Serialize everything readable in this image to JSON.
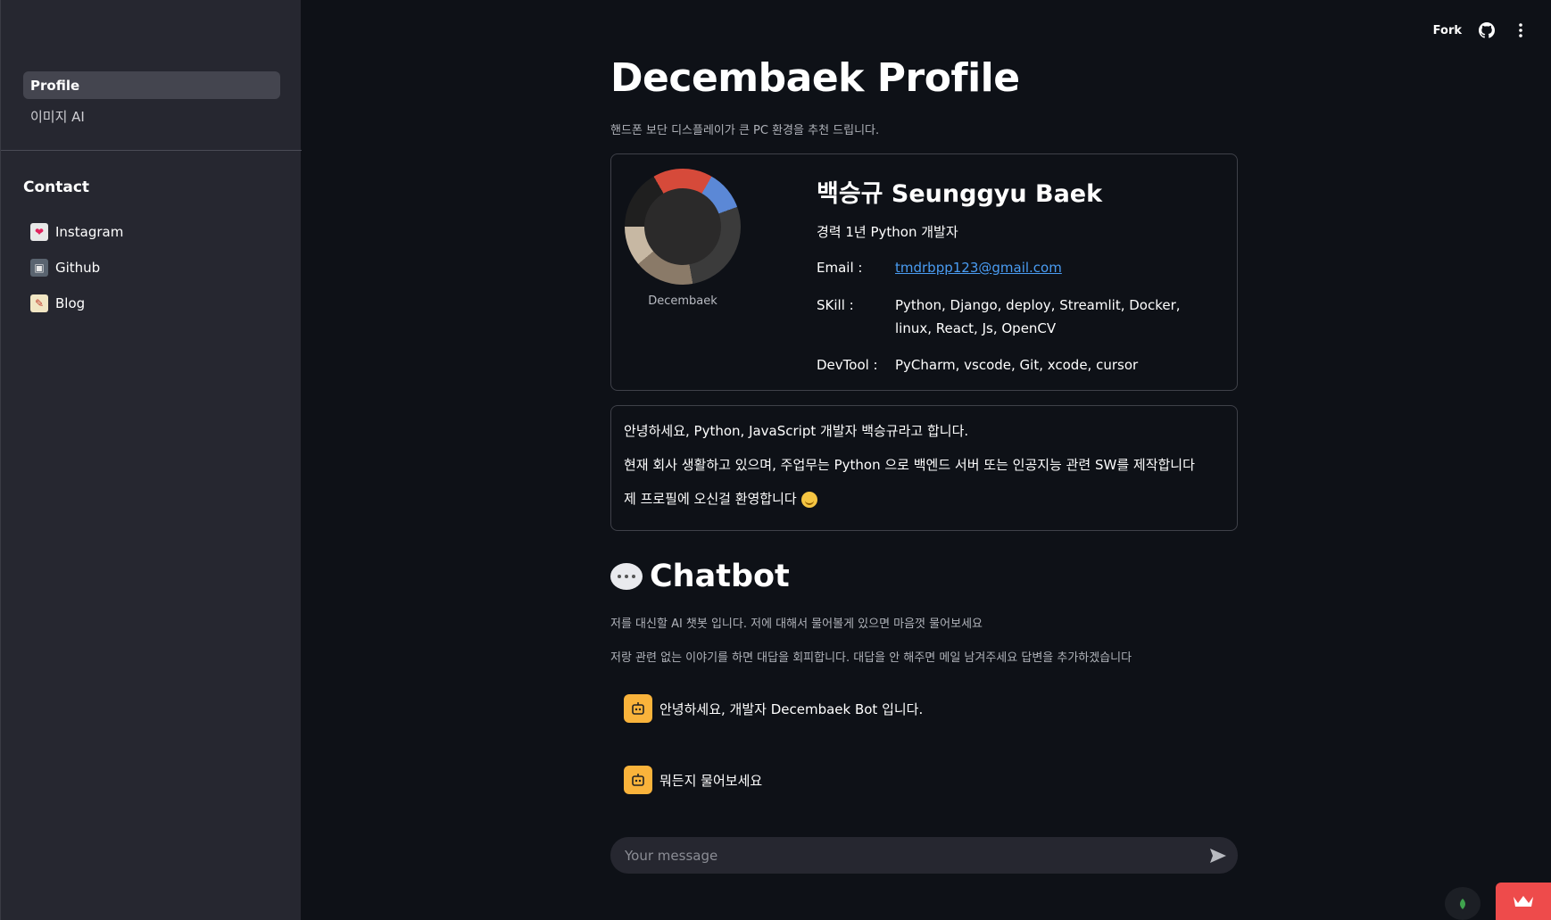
{
  "sidebar": {
    "nav": [
      {
        "label": "Profile",
        "active": true
      },
      {
        "label": "이미지 AI",
        "active": false
      }
    ],
    "contact_title": "Contact",
    "contacts": [
      {
        "label": "Instagram",
        "icon": "heart-letter-icon"
      },
      {
        "label": "Github",
        "icon": "floppy-disk-icon"
      },
      {
        "label": "Blog",
        "icon": "memo-icon"
      }
    ]
  },
  "topbar": {
    "fork_label": "Fork",
    "github_icon": "github-icon",
    "menu_icon": "kebab-menu-icon"
  },
  "main": {
    "title": "Decembaek Profile",
    "subtitle": "핸드폰 보단 디스플레이가 큰 PC 환경을 추천 드립니다.",
    "profile": {
      "avatar_caption": "Decembaek",
      "name": "백승규 Seunggyu Baek",
      "career": "경력 1년 Python 개발자",
      "email_label": "Email :",
      "email_value": "tmdrbpp123@gmail.com",
      "skill_label": "SKill :",
      "skill_value": "Python, Django, deploy, Streamlit, Docker, linux, React, Js, OpenCV",
      "devtool_label": "DevTool :",
      "devtool_value": "PyCharm, vscode, Git, xcode, cursor"
    },
    "intro": [
      "안녕하세요, Python, JavaScript 개발자 백승규라고 합니다.",
      "현재 회사 생활하고 있으며, 주업무는 Python 으로 백엔드 서버 또는 인공지능 관련 SW를 제작합니다",
      "제 프로필에 오신걸 환영합니다"
    ],
    "chatbot": {
      "title": "Chatbot",
      "desc1": "저를 대신할 AI 챗봇 입니다. 저에 대해서 물어볼게 있으면 마음껏 물어보세요",
      "desc2": "저랑 관련 없는 이야기를 하면 대답을 회피합니다. 대답을 안 해주면 메일 남겨주세요 답변을 추가하겠습니다",
      "messages": [
        "안녕하세요, 개발자 Decembaek Bot 입니다.",
        "뭐든지 물어보세요"
      ],
      "input_placeholder": "Your message"
    }
  },
  "colors": {
    "background": "#0e1117",
    "sidebar": "#262730",
    "link": "#4a9cf2",
    "bot_avatar": "#f9b33b",
    "accent_red": "#ee4b4b"
  }
}
